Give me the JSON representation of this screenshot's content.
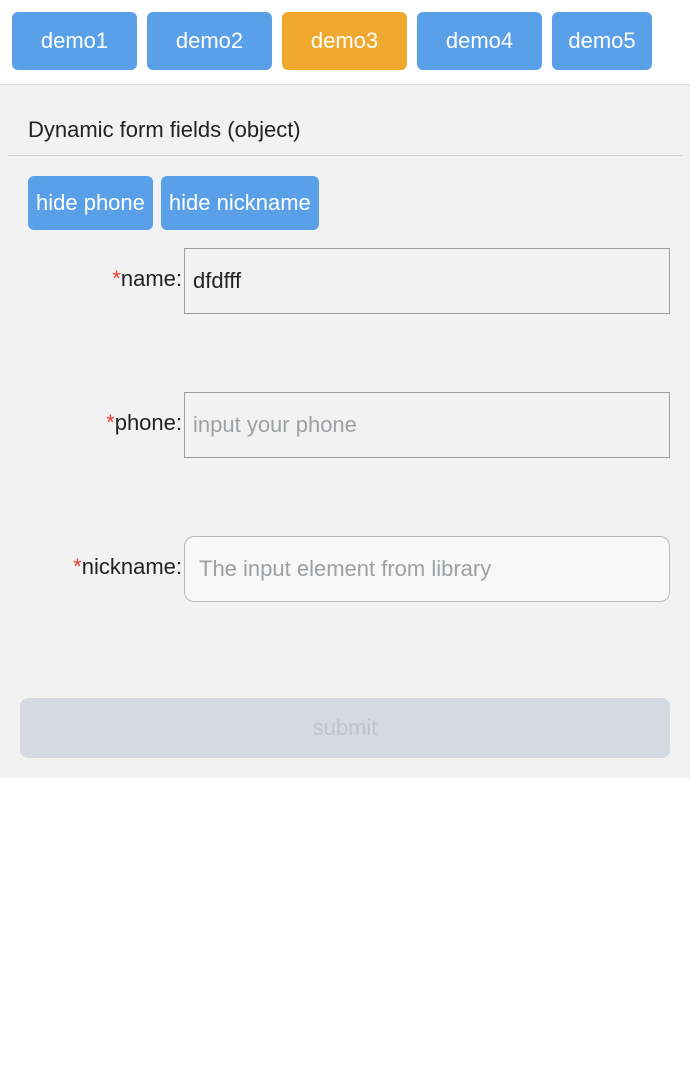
{
  "tabs": [
    {
      "label": "demo1",
      "active": false
    },
    {
      "label": "demo2",
      "active": false
    },
    {
      "label": "demo3",
      "active": true
    },
    {
      "label": "demo4",
      "active": false
    },
    {
      "label": "demo5",
      "active": false
    }
  ],
  "page_title": "Dynamic form fields (object)",
  "toggles": {
    "hide_phone": "hide phone",
    "hide_nickname": "hide nickname"
  },
  "fields": {
    "name": {
      "label": "name:",
      "required": "*",
      "value": "dfdfff",
      "placeholder": ""
    },
    "phone": {
      "label": "phone:",
      "required": "*",
      "value": "",
      "placeholder": "input your phone"
    },
    "nickname": {
      "label": "nickname:",
      "required": "*",
      "value": "",
      "placeholder": "The input element from library"
    }
  },
  "submit_label": "submit"
}
